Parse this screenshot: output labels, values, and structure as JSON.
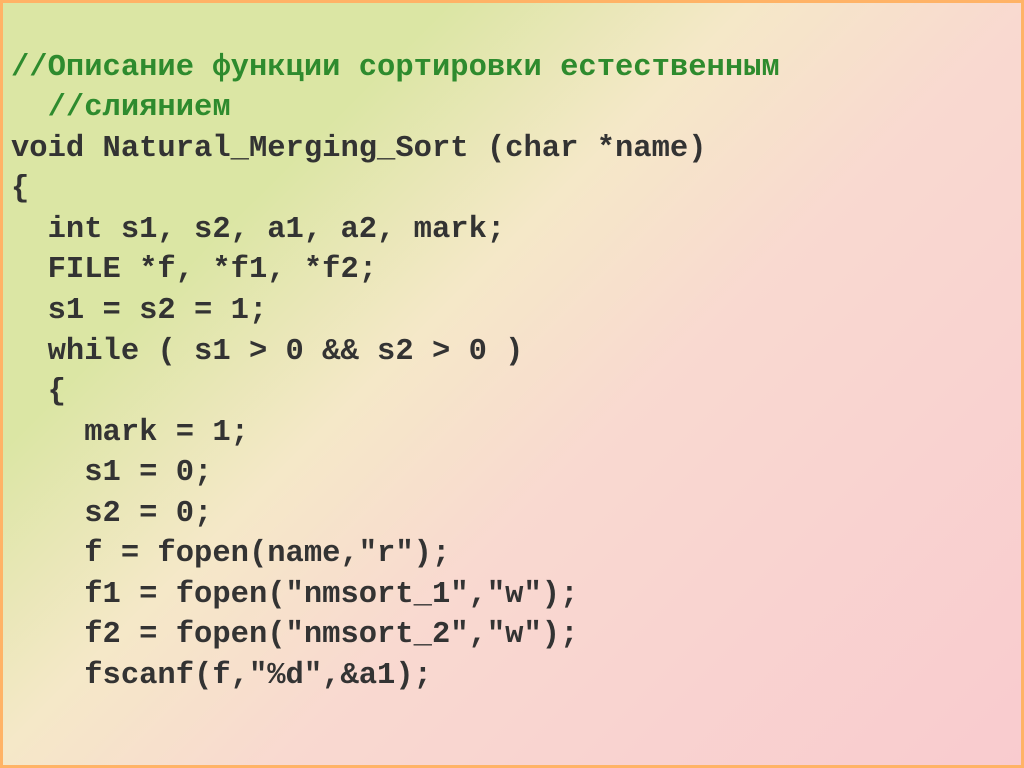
{
  "code": {
    "comment1": "//Описание функции сортировки естественным",
    "comment2": "  //слиянием",
    "line3": "void Natural_Merging_Sort (char *name)",
    "line4": "{",
    "line5": "  int s1, s2, a1, a2, mark;",
    "line6": "  FILE *f, *f1, *f2;",
    "line7": "  s1 = s2 = 1;",
    "line8": "  while ( s1 > 0 && s2 > 0 )",
    "line9": "  {",
    "line10": "    mark = 1;",
    "line11": "    s1 = 0;",
    "line12": "    s2 = 0;",
    "line13": "    f = fopen(name,\"r\");",
    "line14": "    f1 = fopen(\"nmsort_1\",\"w\");",
    "line15": "    f2 = fopen(\"nmsort_2\",\"w\");",
    "line16": "    fscanf(f,\"%d\",&a1);"
  }
}
